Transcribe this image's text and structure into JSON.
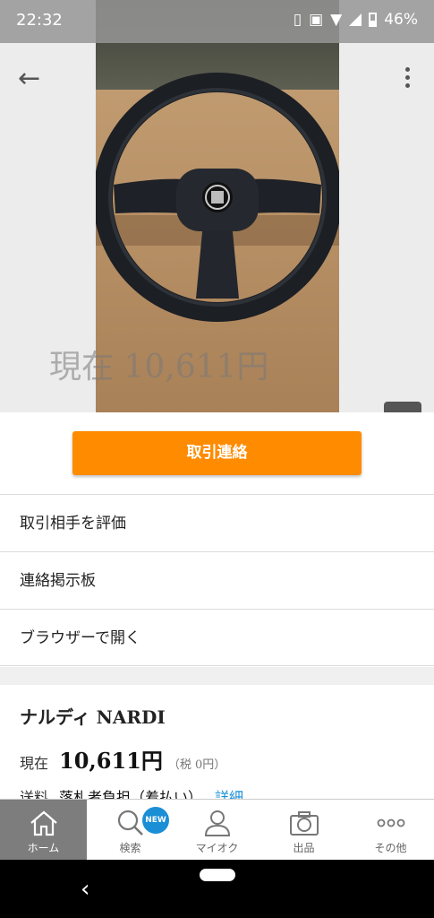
{
  "status_bar": {
    "time": "22:32",
    "battery": "46%"
  },
  "hero": {
    "price_overlay": "現在 10,611円"
  },
  "actions": {
    "contact_label": "取引連絡"
  },
  "menu": {
    "items": [
      {
        "label": "取引相手を評価"
      },
      {
        "label": "連絡掲示板"
      },
      {
        "label": "ブラウザーで開く"
      }
    ]
  },
  "item": {
    "title": "ナルディ NARDI",
    "price_label": "現在",
    "price": "10,611円",
    "tax_note": "（税 0円）",
    "shipping_label": "送料",
    "shipping_value": "落札者負担（着払い）",
    "shipping_link": "詳細"
  },
  "tabbar": {
    "new_badge": "NEW",
    "tabs": [
      {
        "label": "ホーム",
        "icon": "home-icon",
        "active": true
      },
      {
        "label": "検索",
        "icon": "search-icon",
        "active": false
      },
      {
        "label": "マイオク",
        "icon": "person-icon",
        "active": false
      },
      {
        "label": "出品",
        "icon": "camera-icon",
        "active": false
      },
      {
        "label": "その他",
        "icon": "more-dots-icon",
        "active": false
      }
    ]
  },
  "colors": {
    "accent": "#ff8c00",
    "link": "#1a8fd6",
    "active_tab": "#7d7d7d"
  }
}
